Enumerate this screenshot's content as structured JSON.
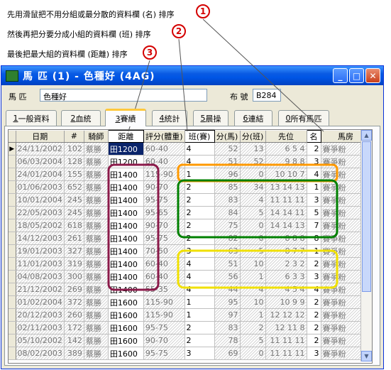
{
  "annotations": [
    {
      "marker": "1",
      "text": "先用滑鼠把不用分組或最分散的資料欄 (名) 排序"
    },
    {
      "marker": "2",
      "text": "然後再把分要分成小組的資料欄 (班) 排序"
    },
    {
      "marker": "3",
      "text": "最後把最大組的資料欄 (距離) 排序"
    }
  ],
  "window": {
    "title": "馬 匹 (1) - 色種好 (4AG)",
    "controls": {
      "minimize": "_",
      "maximize": "□",
      "close": "✕"
    }
  },
  "form": {
    "horse_label": "馬 匹",
    "horse_value": "色種好",
    "brand_label": "布 號",
    "brand_value": "B284"
  },
  "tabs": [
    {
      "key": "1",
      "label": "一般資料"
    },
    {
      "key": "2",
      "label": "血統"
    },
    {
      "key": "3",
      "label": "賽績"
    },
    {
      "key": "4",
      "label": "統計"
    },
    {
      "key": "5",
      "label": "晨操"
    },
    {
      "key": "6",
      "label": "連結"
    },
    {
      "key": "0",
      "label": "所有馬匹"
    }
  ],
  "active_tab": 2,
  "table": {
    "columns": [
      "日期",
      "#",
      "騎師",
      "距離",
      "評分(體重)",
      "班(賽)",
      "分(馬)",
      "分(班)",
      "先位",
      "名",
      "馬房"
    ],
    "rows": [
      [
        "24/11/2002",
        "102",
        "蔡勝",
        "田1200",
        "60-40",
        "4",
        "52",
        "13",
        "6 5 4",
        "2",
        "賽爭粉"
      ],
      [
        "06/03/2004",
        "128",
        "蔡勝",
        "田1200",
        "60-40",
        "4",
        "51",
        "52",
        "9 8 8",
        "3",
        "賽爭粉"
      ],
      [
        "24/01/2004",
        "155",
        "蔡勝",
        "田1400",
        "115-90",
        "1",
        "96",
        "0",
        "10 10 7",
        "4",
        "賽爭粉"
      ],
      [
        "01/06/2003",
        "652",
        "蔡勝",
        "田1400",
        "90-70",
        "2",
        "85",
        "34",
        "13 14 13",
        "1",
        "賽爭粉"
      ],
      [
        "10/01/2004",
        "245",
        "蔡勝",
        "田1400",
        "95-75",
        "2",
        "83",
        "4",
        "11 11 11",
        "3",
        "賽爭粉"
      ],
      [
        "22/05/2003",
        "245",
        "蔡勝",
        "田1400",
        "95-65",
        "2",
        "84",
        "5",
        "14 14 11",
        "5",
        "賽爭粉"
      ],
      [
        "18/05/2002",
        "618",
        "蔡勝",
        "田1400",
        "90-70",
        "2",
        "75",
        "0",
        "14 14 13",
        "7",
        "賽爭粉"
      ],
      [
        "14/12/2003",
        "261",
        "蔡勝",
        "田1400",
        "95-75",
        "2",
        "82",
        "0",
        "8 8 8",
        "8",
        "賽爭粉"
      ],
      [
        "19/01/2003",
        "327",
        "蔡勝",
        "田1400",
        "70-50",
        "3",
        "63",
        "5",
        "8 7 7",
        "1",
        "賽爭粉"
      ],
      [
        "11/01/2003",
        "319",
        "蔡勝",
        "田1400",
        "60-40",
        "4",
        "51",
        "10",
        "2 3 2",
        "2",
        "賽爭粉"
      ],
      [
        "04/08/2003",
        "300",
        "蔡勝",
        "田1400",
        "60-40",
        "4",
        "56",
        "1",
        "6 3 3",
        "3",
        "賽爭粉"
      ],
      [
        "21/12/2002",
        "269",
        "蔡勝",
        "田1400",
        "55-35",
        "4",
        "44",
        "4",
        "4 5 4",
        "4",
        "賽爭粉"
      ],
      [
        "01/02/2004",
        "372",
        "蔡勝",
        "田1600",
        "115-90",
        "1",
        "95",
        "10",
        "10 9 9",
        "2",
        "賽爭粉"
      ],
      [
        "20/12/2003",
        "260",
        "蔡勝",
        "田1600",
        "115-90",
        "1",
        "97",
        "1",
        "12 12 12",
        "2",
        "賽爭粉"
      ],
      [
        "02/11/2003",
        "172",
        "蔡勝",
        "田1600",
        "95-75",
        "2",
        "83",
        "2",
        "12 11 8",
        "2",
        "賽爭粉"
      ],
      [
        "05/10/2002",
        "142",
        "蔡勝",
        "田1600",
        "90-70",
        "2",
        "78",
        "5",
        "11 11 11",
        "2",
        "賽爭粉"
      ],
      [
        "08/02/2003",
        "389",
        "蔡勝",
        "田1600",
        "95-75",
        "3",
        "69",
        "0",
        "11 11 11",
        "3",
        "賽爭粉"
      ]
    ]
  },
  "colors": {
    "marker": "#d40000",
    "highlight_class": "#8b1a4a",
    "highlight_orange": "#ff9900",
    "highlight_green": "#008000",
    "highlight_yellow": "#f0e000"
  }
}
